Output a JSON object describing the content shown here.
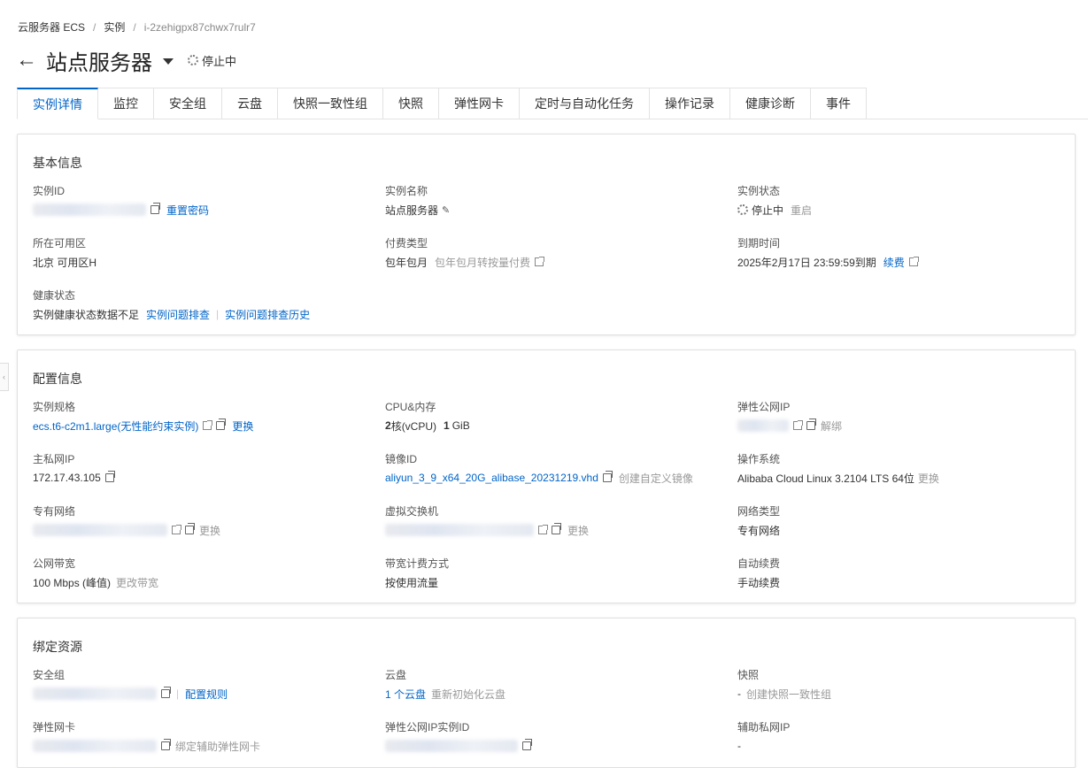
{
  "breadcrumb": {
    "item1": "云服务器 ECS",
    "item2": "实例",
    "item3": "i-2zehigpx87chwx7rulr7",
    "sep": "/"
  },
  "title": {
    "back": "←",
    "text": "站点服务器",
    "status": "停止中"
  },
  "tabs": [
    "实例详情",
    "监控",
    "安全组",
    "云盘",
    "快照一致性组",
    "快照",
    "弹性网卡",
    "定时与自动化任务",
    "操作记录",
    "健康诊断",
    "事件"
  ],
  "basic": {
    "title": "基本信息",
    "instance_id": {
      "label": "实例ID",
      "action": "重置密码"
    },
    "instance_name": {
      "label": "实例名称",
      "value": "站点服务器"
    },
    "instance_status": {
      "label": "实例状态",
      "value": "停止中",
      "action": "重启"
    },
    "zone": {
      "label": "所在可用区",
      "value": "北京 可用区H"
    },
    "billing": {
      "label": "付费类型",
      "value": "包年包月",
      "action": "包年包月转按量付费"
    },
    "expire": {
      "label": "到期时间",
      "value": "2025年2月17日 23:59:59到期",
      "action": "续费"
    },
    "health": {
      "label": "健康状态",
      "value": "实例健康状态数据不足",
      "action1": "实例问题排查",
      "action2": "实例问题排查历史",
      "sep": "|"
    }
  },
  "config": {
    "title": "配置信息",
    "spec": {
      "label": "实例规格",
      "value": "ecs.t6-c2m1.large(无性能约束实例)",
      "action": "更换"
    },
    "cpu": {
      "label": "CPU&内存",
      "cpu_num": "2",
      "cpu_unit": "核(vCPU)",
      "mem_num": "1",
      "mem_unit": "GiB"
    },
    "eip": {
      "label": "弹性公网IP",
      "action": "解绑"
    },
    "private_ip": {
      "label": "主私网IP",
      "value": "172.17.43.105"
    },
    "image": {
      "label": "镜像ID",
      "value": "aliyun_3_9_x64_20G_alibase_20231219.vhd",
      "action": "创建自定义镜像"
    },
    "os": {
      "label": "操作系统",
      "value": "Alibaba Cloud Linux 3.2104 LTS 64位",
      "action": "更换"
    },
    "vpc": {
      "label": "专有网络",
      "action": "更换"
    },
    "vswitch": {
      "label": "虚拟交换机",
      "action": "更换"
    },
    "net_type": {
      "label": "网络类型",
      "value": "专有网络"
    },
    "bandwidth": {
      "label": "公网带宽",
      "value": "100 Mbps (峰值)",
      "action": "更改带宽"
    },
    "bw_billing": {
      "label": "带宽计费方式",
      "value": "按使用流量"
    },
    "auto_renew": {
      "label": "自动续费",
      "value": "手动续费"
    }
  },
  "bind": {
    "title": "绑定资源",
    "sg": {
      "label": "安全组",
      "action": "配置规则"
    },
    "disk": {
      "label": "云盘",
      "value": "1 个云盘",
      "action": "重新初始化云盘"
    },
    "snapshot": {
      "label": "快照",
      "value": "-",
      "action": "创建快照一致性组"
    },
    "eni": {
      "label": "弹性网卡",
      "action": "绑定辅助弹性网卡"
    },
    "eip_id": {
      "label": "弹性公网IP实例ID"
    },
    "sec_ip": {
      "label": "辅助私网IP",
      "value": "-"
    }
  },
  "colors": {
    "link": "#0064c8",
    "muted": "#999999"
  }
}
